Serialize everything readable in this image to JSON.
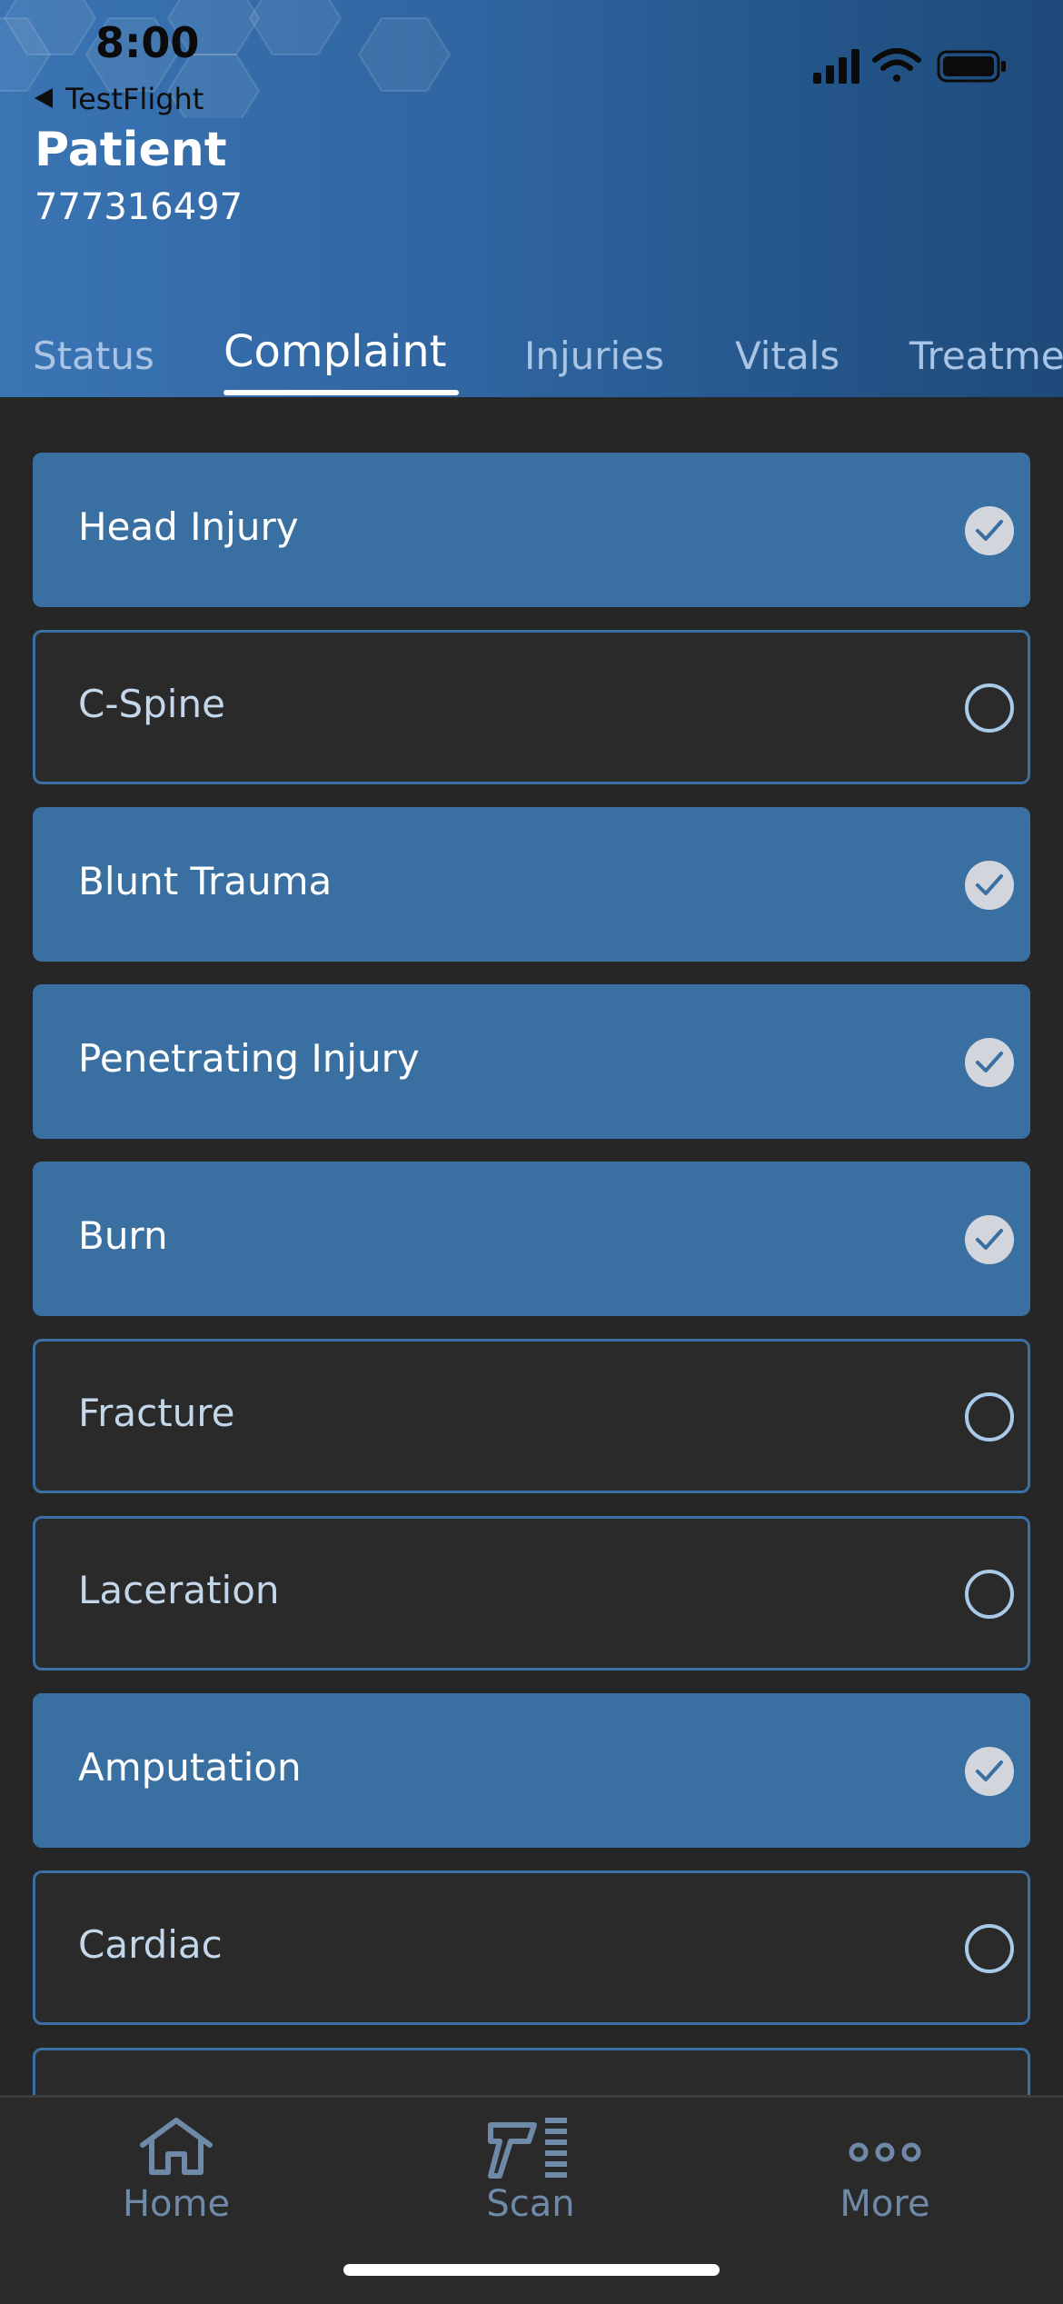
{
  "status_bar": {
    "time": "8:00"
  },
  "header": {
    "back_label": "TestFlight",
    "title": "Patient",
    "patient_id": "777316497"
  },
  "tabs": [
    {
      "label": "Status",
      "active": false
    },
    {
      "label": "Complaint",
      "active": true
    },
    {
      "label": "Injuries",
      "active": false
    },
    {
      "label": "Vitals",
      "active": false
    },
    {
      "label": "Treatme",
      "active": false
    }
  ],
  "complaints": [
    {
      "label": "Head Injury",
      "checked": true
    },
    {
      "label": "C-Spine",
      "checked": false
    },
    {
      "label": "Blunt Trauma",
      "checked": true
    },
    {
      "label": "Penetrating Injury",
      "checked": true
    },
    {
      "label": "Burn",
      "checked": true
    },
    {
      "label": "Fracture",
      "checked": false
    },
    {
      "label": "Laceration",
      "checked": false
    },
    {
      "label": "Amputation",
      "checked": true
    },
    {
      "label": "Cardiac",
      "checked": false
    }
  ],
  "bottom_nav": [
    {
      "label": "Home",
      "icon": "home-icon"
    },
    {
      "label": "Scan",
      "icon": "barcode-scanner-icon"
    },
    {
      "label": "More",
      "icon": "more-icon"
    }
  ],
  "colors": {
    "accent": "#3a6fa1",
    "background": "#262626",
    "header_gradient_start": "#3a74b3",
    "header_gradient_end": "#1d4a79"
  }
}
